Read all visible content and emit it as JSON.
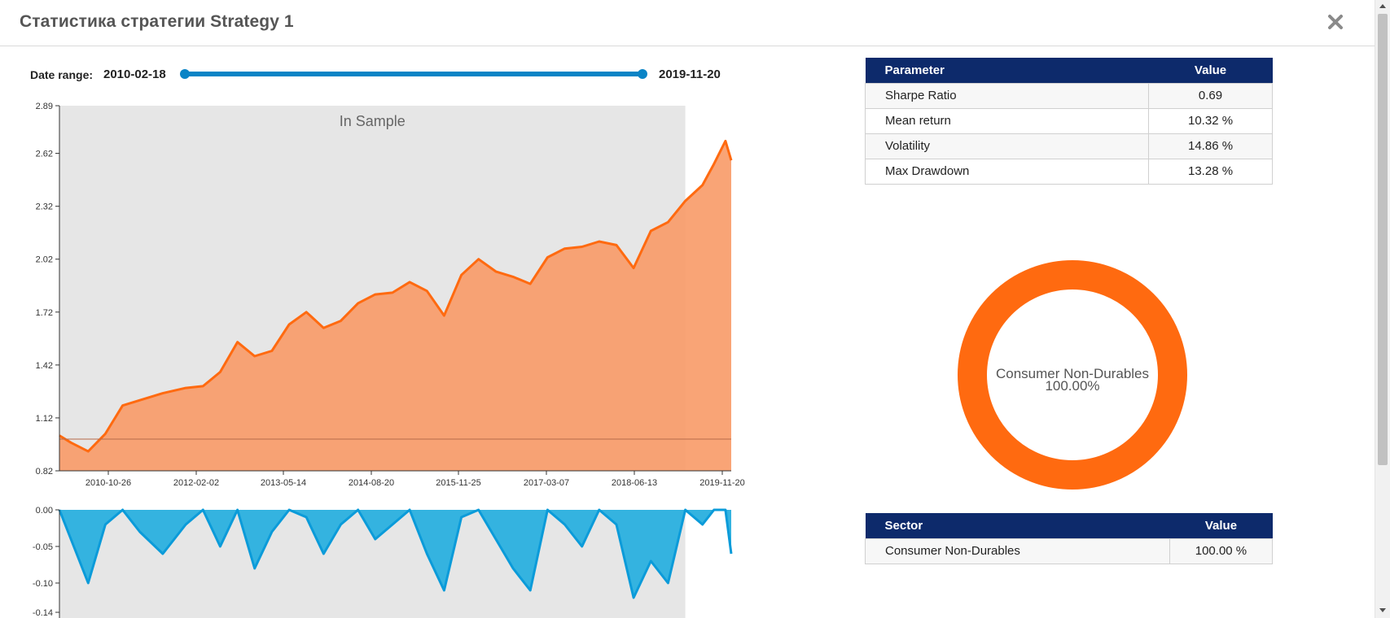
{
  "title": "Статистика стратегии Strategy 1",
  "date_range": {
    "label": "Date range:",
    "start": "2010-02-18",
    "end": "2019-11-20"
  },
  "colors": {
    "equity_line": "#ff6a10",
    "equity_fill": "#f99c6a",
    "drawdown_line": "#0b9bd9",
    "drawdown_fill": "#34b3e0",
    "in_sample_bg": "#e6e6e6",
    "table_header": "#0d2a6b",
    "donut": "#ff6a10"
  },
  "chart_data": [
    {
      "type": "area",
      "annotation": "In Sample",
      "y_ticks": [
        "2.89",
        "2.62",
        "2.32",
        "2.02",
        "1.72",
        "1.42",
        "1.12",
        "0.82"
      ],
      "x_ticks": [
        "2010-10-26",
        "2012-02-02",
        "2013-05-14",
        "2014-08-20",
        "2015-11-25",
        "2017-03-07",
        "2018-06-13",
        "2019-11-20"
      ],
      "ylim": [
        0.82,
        2.89
      ],
      "baseline": 1.0,
      "in_sample_end": "2019-03",
      "x": [
        "2010-02",
        "2010-04",
        "2010-07",
        "2010-10",
        "2011-01",
        "2011-04",
        "2011-08",
        "2011-12",
        "2012-03",
        "2012-06",
        "2012-09",
        "2012-12",
        "2013-03",
        "2013-06",
        "2013-09",
        "2013-12",
        "2014-03",
        "2014-06",
        "2014-09",
        "2014-12",
        "2015-03",
        "2015-06",
        "2015-09",
        "2015-12",
        "2016-03",
        "2016-06",
        "2016-09",
        "2016-12",
        "2017-03",
        "2017-06",
        "2017-09",
        "2017-12",
        "2018-03",
        "2018-06",
        "2018-09",
        "2018-12",
        "2019-03",
        "2019-06",
        "2019-08",
        "2019-10",
        "2019-11"
      ],
      "values": [
        1.02,
        0.98,
        0.93,
        1.03,
        1.19,
        1.22,
        1.26,
        1.29,
        1.3,
        1.38,
        1.55,
        1.47,
        1.5,
        1.65,
        1.72,
        1.63,
        1.67,
        1.77,
        1.82,
        1.83,
        1.89,
        1.84,
        1.7,
        1.93,
        2.02,
        1.95,
        1.92,
        1.88,
        2.03,
        2.08,
        2.09,
        2.12,
        2.1,
        1.97,
        2.18,
        2.23,
        2.35,
        2.44,
        2.56,
        2.69,
        2.58
      ]
    },
    {
      "type": "area",
      "y_ticks": [
        "0.00",
        "-0.05",
        "-0.10",
        "-0.14"
      ],
      "ylim": [
        -0.14,
        0.0
      ],
      "x": [
        "2010-02",
        "2010-04",
        "2010-07",
        "2010-10",
        "2011-01",
        "2011-04",
        "2011-08",
        "2011-12",
        "2012-03",
        "2012-06",
        "2012-09",
        "2012-12",
        "2013-03",
        "2013-06",
        "2013-09",
        "2013-12",
        "2014-03",
        "2014-06",
        "2014-09",
        "2014-12",
        "2015-03",
        "2015-06",
        "2015-09",
        "2015-12",
        "2016-03",
        "2016-06",
        "2016-09",
        "2016-12",
        "2017-03",
        "2017-06",
        "2017-09",
        "2017-12",
        "2018-03",
        "2018-06",
        "2018-09",
        "2018-12",
        "2019-03",
        "2019-06",
        "2019-08",
        "2019-10",
        "2019-11"
      ],
      "values": [
        0.0,
        -0.04,
        -0.1,
        -0.02,
        0.0,
        -0.03,
        -0.06,
        -0.02,
        0.0,
        -0.05,
        0.0,
        -0.08,
        -0.03,
        0.0,
        -0.01,
        -0.06,
        -0.02,
        0.0,
        -0.04,
        -0.02,
        0.0,
        -0.06,
        -0.11,
        -0.01,
        0.0,
        -0.04,
        -0.08,
        -0.11,
        0.0,
        -0.02,
        -0.05,
        0.0,
        -0.02,
        -0.12,
        -0.07,
        -0.1,
        0.0,
        -0.02,
        0.0,
        0.0,
        -0.06
      ]
    },
    {
      "type": "pie",
      "categories": [
        "Consumer Non-Durables"
      ],
      "values": [
        100.0
      ],
      "center_label": "Consumer Non-Durables",
      "center_value": "100.00%"
    }
  ],
  "parameters_table": {
    "headers": [
      "Parameter",
      "Value"
    ],
    "rows": [
      [
        "Sharpe Ratio",
        "0.69"
      ],
      [
        "Mean return",
        "10.32 %"
      ],
      [
        "Volatility",
        "14.86 %"
      ],
      [
        "Max Drawdown",
        "13.28 %"
      ]
    ]
  },
  "sector_table": {
    "headers": [
      "Sector",
      "Value"
    ],
    "rows": [
      [
        "Consumer Non-Durables",
        "100.00 %"
      ]
    ]
  }
}
